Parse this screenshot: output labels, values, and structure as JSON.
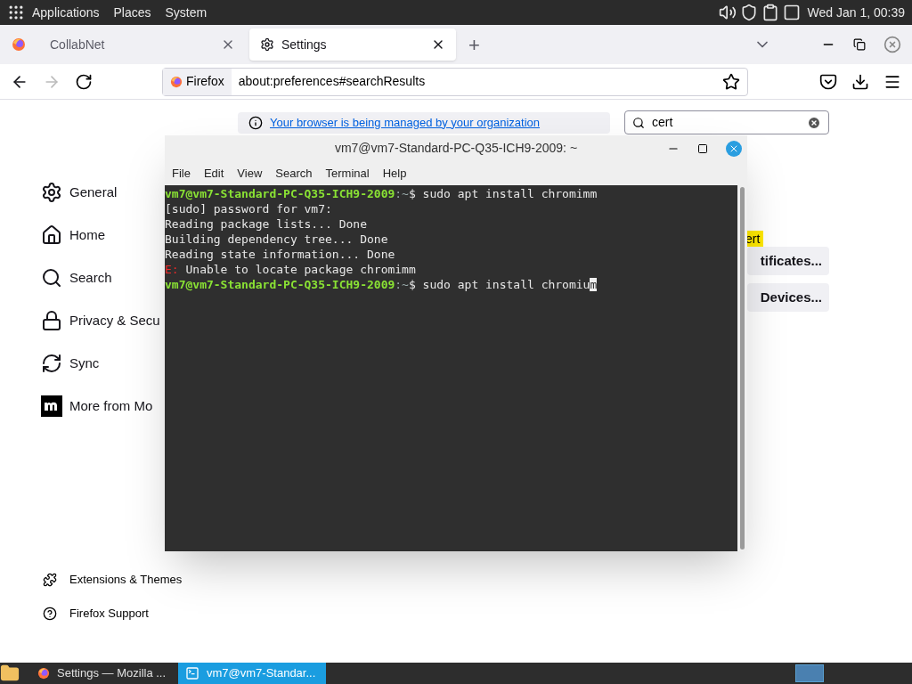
{
  "top_panel": {
    "menus": [
      "Applications",
      "Places",
      "System"
    ],
    "clock": "Wed Jan 1, 00:39"
  },
  "browser": {
    "tabs": [
      {
        "label": "CollabNet",
        "selected": false
      },
      {
        "label": "Settings",
        "selected": true
      }
    ],
    "new_tab": "+",
    "nav": {
      "back_disabled": false,
      "forward_disabled": true
    },
    "urlbar": {
      "identity": "Firefox",
      "url": "about:preferences#searchResults"
    },
    "sidebar": [
      {
        "label": "General"
      },
      {
        "label": "Home"
      },
      {
        "label": "Search"
      },
      {
        "label": "Privacy & Secu"
      },
      {
        "label": "Sync"
      },
      {
        "label": "More from Mo"
      }
    ],
    "sidebar_footer": [
      {
        "label": "Extensions & Themes"
      },
      {
        "label": "Firefox Support"
      }
    ],
    "banner": "Your browser is being managed by your organization",
    "search": {
      "value": "cert"
    },
    "highlight": "ert",
    "buttons": [
      "tificates...",
      "Devices..."
    ]
  },
  "terminal": {
    "title": "vm7@vm7-Standard-PC-Q35-ICH9-2009: ~",
    "menu": [
      "File",
      "Edit",
      "View",
      "Search",
      "Terminal",
      "Help"
    ],
    "lines": [
      {
        "kind": "prompt",
        "user": "vm7@vm7-Standard-PC-Q35-ICH9-2009",
        "path": ":~",
        "symbol": "$",
        "command": "sudo apt install chromimm"
      },
      {
        "kind": "output",
        "text": "[sudo] password for vm7:"
      },
      {
        "kind": "output",
        "text": "Reading package lists... Done"
      },
      {
        "kind": "output",
        "text": "Building dependency tree... Done"
      },
      {
        "kind": "output",
        "text": "Reading state information... Done"
      },
      {
        "kind": "error",
        "label": "E:",
        "text": "Unable to locate package chromimm"
      },
      {
        "kind": "prompt",
        "user": "vm7@vm7-Standard-PC-Q35-ICH9-2009",
        "path": ":~",
        "symbol": "$",
        "command": "sudo apt install chromiu",
        "cursor": "m"
      }
    ]
  },
  "taskbar": [
    {
      "label": "Settings — Mozilla ...",
      "selected": false
    },
    {
      "label": "vm7@vm7-Standar...",
      "selected": true
    }
  ]
}
